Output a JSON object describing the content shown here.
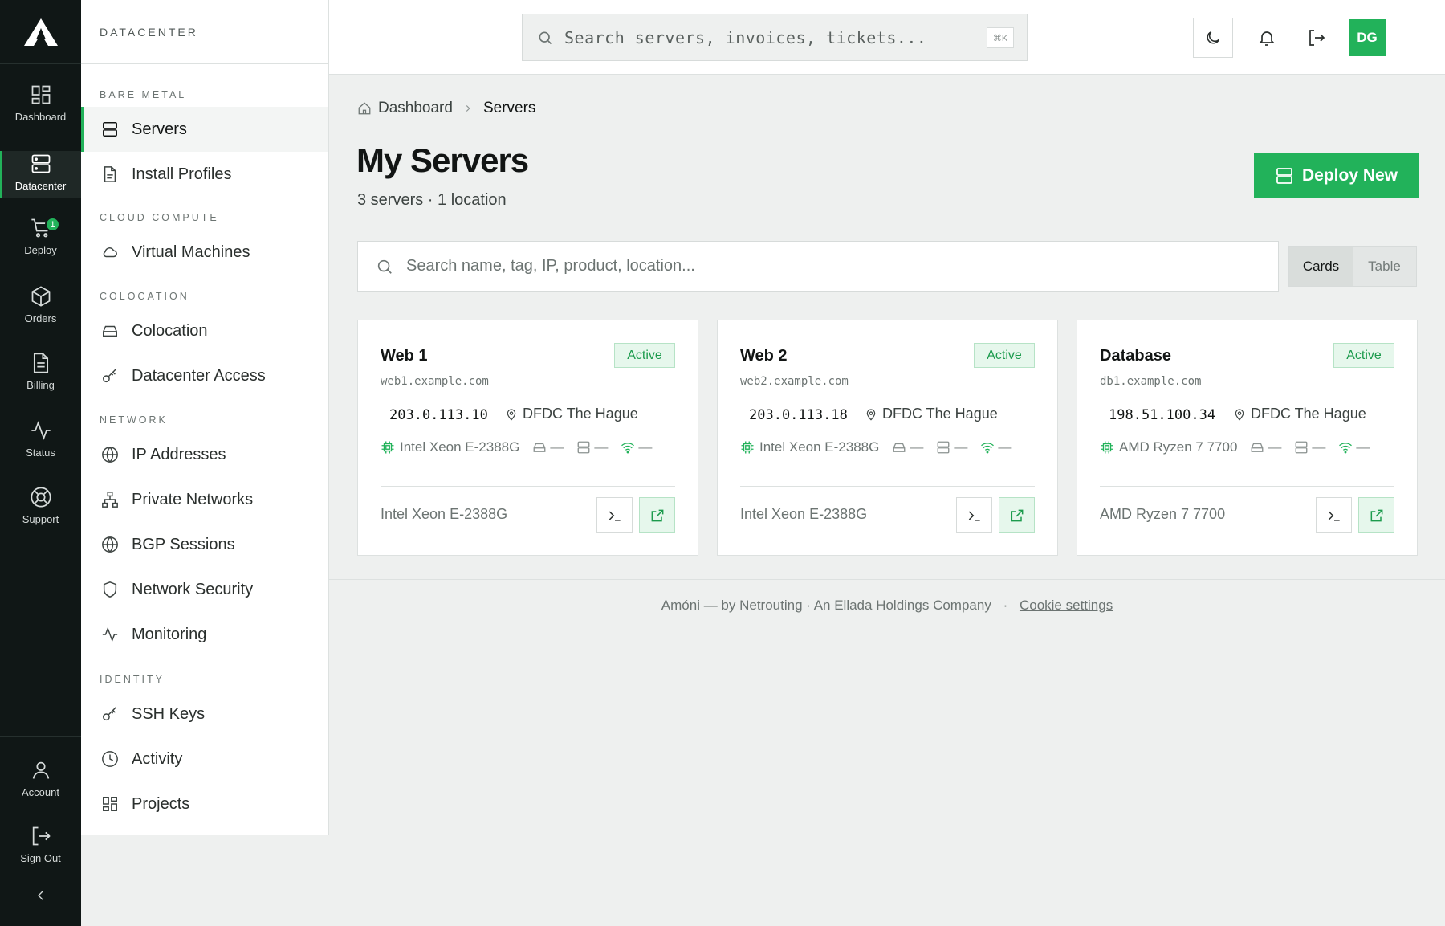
{
  "rail": {
    "items": [
      {
        "label": "Dashboard",
        "icon": "grid-icon"
      },
      {
        "label": "Datacenter",
        "icon": "server-icon"
      },
      {
        "label": "Deploy",
        "icon": "cart-icon",
        "badge": "1"
      },
      {
        "label": "Orders",
        "icon": "box-icon"
      },
      {
        "label": "Billing",
        "icon": "document-icon"
      },
      {
        "label": "Status",
        "icon": "activity-icon"
      },
      {
        "label": "Support",
        "icon": "lifebuoy-icon"
      }
    ],
    "bottom": [
      {
        "label": "Account",
        "icon": "user-icon"
      },
      {
        "label": "Sign Out",
        "icon": "sign-out-icon"
      }
    ]
  },
  "sidebar": {
    "title": "DATACENTER",
    "sections": [
      {
        "title": "BARE METAL",
        "items": [
          {
            "label": "Servers",
            "icon": "server-icon"
          },
          {
            "label": "Install Profiles",
            "icon": "file-icon"
          }
        ]
      },
      {
        "title": "CLOUD COMPUTE",
        "items": [
          {
            "label": "Virtual Machines",
            "icon": "cloud-icon"
          }
        ]
      },
      {
        "title": "COLOCATION",
        "items": [
          {
            "label": "Colocation",
            "icon": "hard-drive-icon"
          },
          {
            "label": "Datacenter Access",
            "icon": "key-icon"
          }
        ]
      },
      {
        "title": "NETWORK",
        "items": [
          {
            "label": "IP Addresses",
            "icon": "globe-icon"
          },
          {
            "label": "Private Networks",
            "icon": "network-icon"
          },
          {
            "label": "BGP Sessions",
            "icon": "globe-icon"
          },
          {
            "label": "Network Security",
            "icon": "shield-icon"
          },
          {
            "label": "Monitoring",
            "icon": "activity-icon"
          }
        ]
      },
      {
        "title": "IDENTITY",
        "items": [
          {
            "label": "SSH Keys",
            "icon": "key-icon"
          },
          {
            "label": "Activity",
            "icon": "clock-icon"
          },
          {
            "label": "Projects",
            "icon": "grid-icon"
          }
        ]
      }
    ]
  },
  "header": {
    "search_placeholder": "Search servers, invoices, tickets...",
    "shortcut": "⌘K",
    "avatar": "DG"
  },
  "breadcrumb": {
    "home": "Dashboard",
    "current": "Servers"
  },
  "page": {
    "title": "My Servers",
    "subtitle": "3 servers · 1 location",
    "deploy_label": "Deploy New",
    "filter_placeholder": "Search name, tag, IP, product, location...",
    "view_options": [
      "Cards",
      "Table"
    ],
    "view_selected": "Cards"
  },
  "servers": [
    {
      "name": "Web 1",
      "host": "web1.example.com",
      "status": "Active",
      "ip": "203.0.113.10",
      "location": "DFDC The Hague",
      "cpu": "Intel Xeon E-2388G",
      "disk": "—",
      "ram": "—",
      "net": "—",
      "product": "Intel Xeon E-2388G"
    },
    {
      "name": "Web 2",
      "host": "web2.example.com",
      "status": "Active",
      "ip": "203.0.113.18",
      "location": "DFDC The Hague",
      "cpu": "Intel Xeon E-2388G",
      "disk": "—",
      "ram": "—",
      "net": "—",
      "product": "Intel Xeon E-2388G"
    },
    {
      "name": "Database",
      "host": "db1.example.com",
      "status": "Active",
      "ip": "198.51.100.34",
      "location": "DFDC The Hague",
      "cpu": "AMD Ryzen 7 7700",
      "disk": "—",
      "ram": "—",
      "net": "—",
      "product": "AMD Ryzen 7 7700"
    }
  ],
  "footer": {
    "text": "Amóni — by Netrouting · An Ellada Holdings Company",
    "sep": "·",
    "link": "Cookie settings"
  },
  "colors": {
    "accent": "#22b25a",
    "rail_bg": "#101716",
    "page_bg": "#eef0ef"
  }
}
